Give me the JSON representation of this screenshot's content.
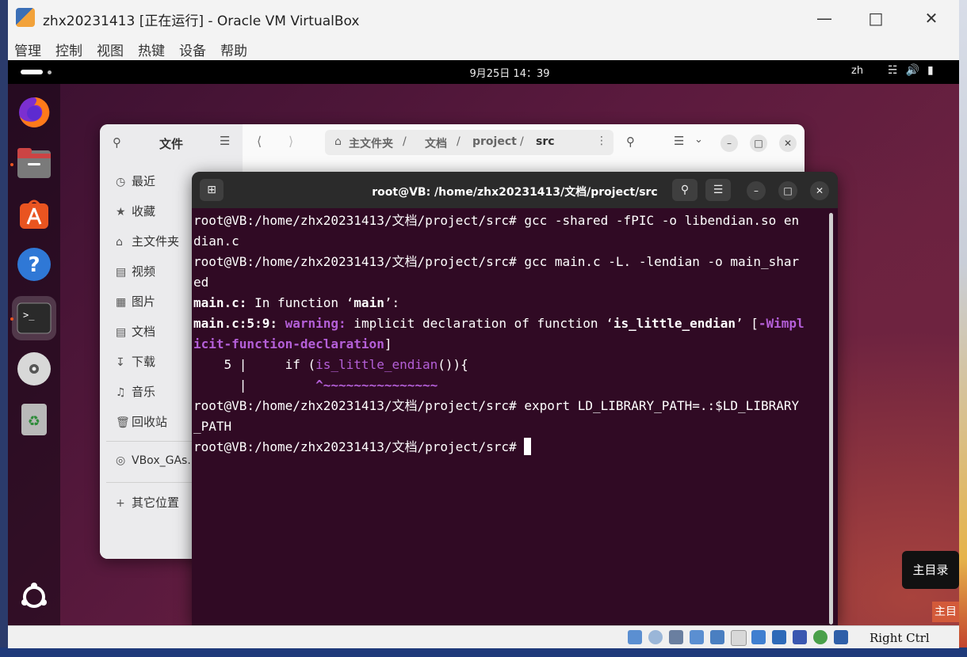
{
  "vbox": {
    "title": "zhx20231413 [正在运行] - Oracle VM VirtualBox",
    "menu": [
      "管理",
      "控制",
      "视图",
      "热键",
      "设备",
      "帮助"
    ],
    "host_key": "Right Ctrl"
  },
  "topbar": {
    "clock": "9月25日  14：39",
    "lang": "zh"
  },
  "dock": {
    "items": [
      "firefox-icon",
      "files-icon",
      "app-center-icon",
      "help-icon",
      "terminal-icon",
      "dvd-icon",
      "trash-icon"
    ],
    "apps_grid": "ubuntu-logo-icon"
  },
  "files": {
    "title": "文件",
    "path": [
      "主文件夹",
      "文档",
      "project",
      "src"
    ],
    "sidebar": [
      "最近",
      "收藏",
      "主文件夹",
      "视频",
      "图片",
      "文档",
      "下载",
      "音乐",
      "回收站",
      "VBox_GAs...",
      "其它位置"
    ]
  },
  "terminal": {
    "title": "root@VB: /home/zhx20231413/文档/project/src",
    "prompt": "root@VB:/home/zhx20231413/文档/project/src# ",
    "lines": {
      "l1_cmd": "gcc -shared -fPIC -o libendian.so en",
      "l2": "dian.c",
      "l3_cmd": "gcc main.c -L. -lendian -o main_shar",
      "l4": "ed",
      "l5_a": "main.c:",
      "l5_b": " In function ‘",
      "l5_c": "main",
      "l5_d": "’:",
      "l6_a": "main.c:5:9:",
      "l6_b": "warning:",
      "l6_c": " implicit declaration of function ‘",
      "l6_d": "is_little_endian",
      "l6_e": "’ [",
      "l6_f": "-Wimpl",
      "l7_a": "icit-function-declaration",
      "l7_b": "]",
      "l8_a": "    5 |     if (",
      "l8_b": "is_little_endian",
      "l8_c": "()){",
      "l9_a": "      |         ",
      "l9_b": "^~~~~~~~~~~~~~~~",
      "l10_cmd": "export LD_LIBRARY_PATH=.:$LD_LIBRARY",
      "l11": "_PATH"
    }
  },
  "host": {
    "home_label": "主目录",
    "home_label2": "主目"
  },
  "colors": {
    "terminal_bg": "#300a24",
    "warning": "#b45fd8",
    "ubuntu_orange": "#e95420"
  }
}
